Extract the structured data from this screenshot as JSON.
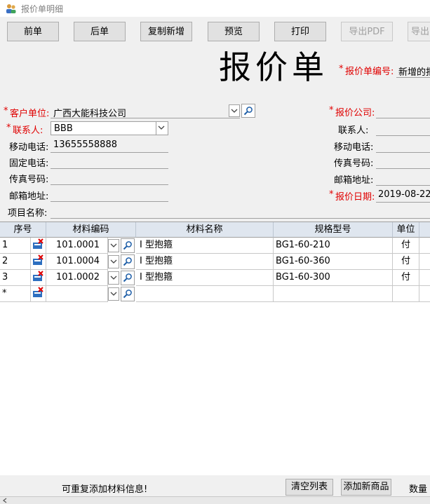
{
  "window": {
    "title": "报价单明细"
  },
  "toolbar": {
    "prev": "前单",
    "next": "后单",
    "copy_new": "复制新增",
    "preview": "预览",
    "print": "打印",
    "export_pdf": "导出PDF",
    "export_other": "导出"
  },
  "doc_title": "报价单",
  "quote_no": {
    "label": "报价单编号:",
    "value": "新增的报"
  },
  "left_form": {
    "customer_label": "客户单位:",
    "customer_value": "广西大能科技公司",
    "contact_label": "联系人:",
    "contact_value": "BBB",
    "mobile_label": "移动电话:",
    "mobile_value": "13655558888",
    "phone_label": "固定电话:",
    "phone_value": "",
    "fax_label": "传真号码:",
    "fax_value": "",
    "email_label": "邮箱地址:",
    "email_value": "",
    "project_label": "项目名称:",
    "project_value": ""
  },
  "right_form": {
    "company_label": "报价公司:",
    "contact_label": "联系人:",
    "mobile_label": "移动电话:",
    "fax_label": "传真号码:",
    "email_label": "邮箱地址:",
    "date_label": "报价日期:",
    "date_value": "2019-08-22"
  },
  "grid": {
    "columns": [
      "序号",
      "材料编码",
      "材料名称",
      "规格型号",
      "单位"
    ],
    "rows": [
      {
        "seq": "1",
        "code": "101.0001",
        "name": "I 型抱箍",
        "spec": "BG1-60-210",
        "unit": "付"
      },
      {
        "seq": "2",
        "code": "101.0004",
        "name": "I 型抱箍",
        "spec": "BG1-60-360",
        "unit": "付"
      },
      {
        "seq": "3",
        "code": "101.0002",
        "name": "I 型抱箍",
        "spec": "BG1-60-300",
        "unit": "付"
      }
    ],
    "new_row_marker": "*"
  },
  "footer": {
    "hint": "可重复添加材料信息!",
    "clear_list": "清空列表",
    "add_product": "添加新商品",
    "quantity_label": "数量"
  }
}
